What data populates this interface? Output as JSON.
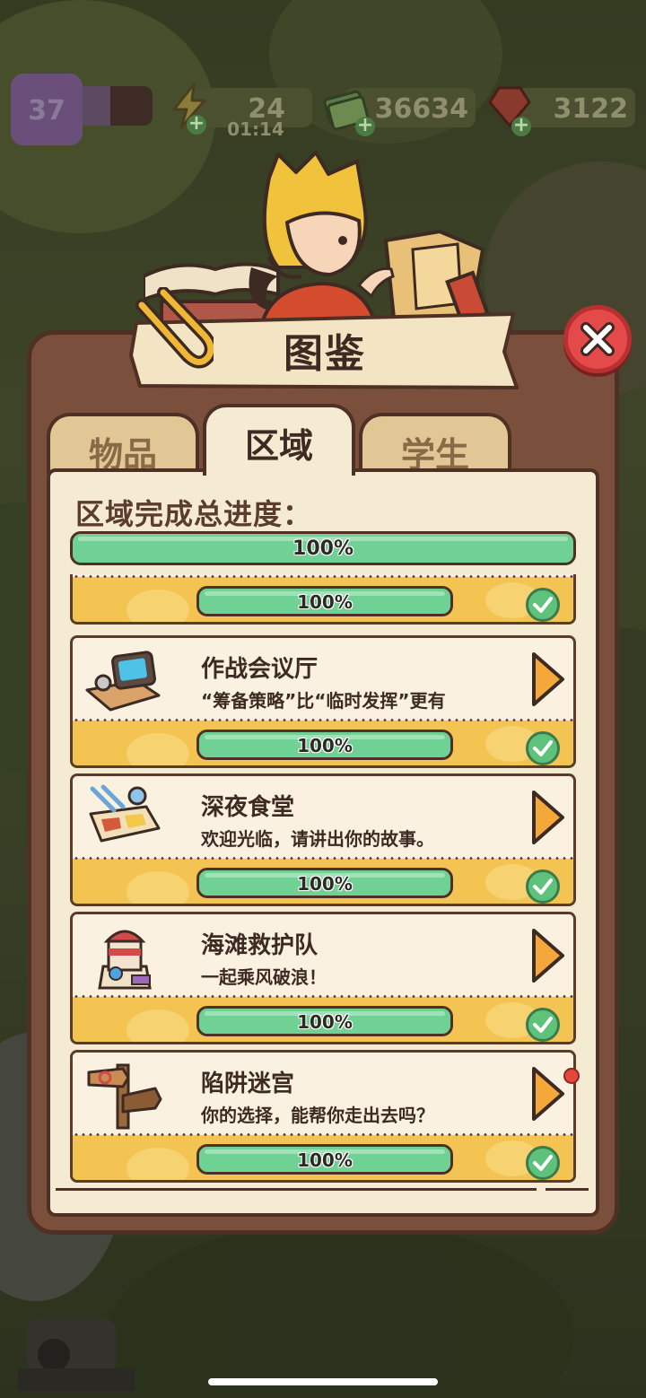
{
  "hud": {
    "level": "37",
    "energy": "24",
    "energy_timer": "01:14",
    "cash": "36634",
    "gems": "3122",
    "xp_fill": 0.45
  },
  "panel": {
    "title": "图鉴",
    "tabs": [
      {
        "label": "物品",
        "active": false
      },
      {
        "label": "区域",
        "active": true
      },
      {
        "label": "学生",
        "active": false
      }
    ],
    "overall_label": "区域完成总进度：",
    "overall_progress": "100%"
  },
  "areas": [
    {
      "name": "",
      "desc": "",
      "progress": "100%",
      "icon": "partial-area-icon"
    },
    {
      "name": "作战会议厅",
      "desc": "“筹备策略”比“临时发挥”更有",
      "progress": "100%",
      "icon": "tv-monitor-icon"
    },
    {
      "name": "深夜食堂",
      "desc": "欢迎光临，请讲出你的故事。",
      "progress": "100%",
      "icon": "food-tray-icon"
    },
    {
      "name": "海滩救护队",
      "desc": "一起乘风破浪！",
      "progress": "100%",
      "icon": "lighthouse-icon"
    },
    {
      "name": "陷阱迷宫",
      "desc": "你的选择，能帮你走出去吗？",
      "progress": "100%",
      "icon": "signpost-icon"
    }
  ],
  "colors": {
    "panel_brown": "#7a4f3c",
    "progress_green": "#6fd193",
    "card_yellow": "#f4c453",
    "close_red": "#e54a4a",
    "arrow_orange": "#f5a83a"
  }
}
